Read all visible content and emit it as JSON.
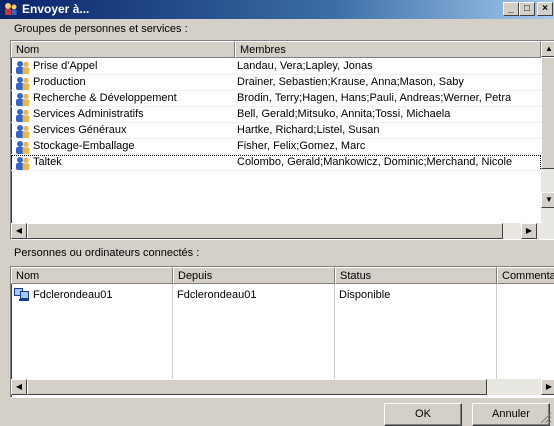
{
  "window": {
    "title": "Envoyer à...",
    "buttons": [
      "_",
      "□",
      "×"
    ]
  },
  "groups": {
    "label": "Groupes de personnes et services :",
    "columns": [
      "Nom",
      "Membres"
    ],
    "rows": [
      {
        "name": "Prise d'Appel",
        "members": "Landau, Vera;Lapley, Jonas"
      },
      {
        "name": "Production",
        "members": "Drainer, Sebastien;Krause, Anna;Mason, Saby"
      },
      {
        "name": "Recherche & Développement",
        "members": "Brodin, Terry;Hagen, Hans;Pauli, Andreas;Werner, Petra"
      },
      {
        "name": "Services Administratifs",
        "members": "Bell, Gerald;Mitsuko, Annita;Tossi, Michaela"
      },
      {
        "name": "Services Généraux",
        "members": "Hartke, Richard;Listel, Susan"
      },
      {
        "name": "Stockage-Emballage",
        "members": "Fisher, Felix;Gomez, Marc"
      },
      {
        "name": "Taltek",
        "members": "Colombo, Gerald;Mankowicz, Dominic;Merchand, Nicole"
      }
    ],
    "selected_row": "Taltek"
  },
  "connected": {
    "label": "Personnes ou ordinateurs connectés :",
    "columns": [
      "Nom",
      "Depuis",
      "Status",
      "Commentaire"
    ],
    "rows": [
      {
        "name": "Fdclerondeau01",
        "since": "Fdclerondeau01",
        "status": "Disponible",
        "comment": ""
      }
    ]
  },
  "footer": {
    "ok_label": "OK",
    "cancel_label": "Annuler"
  },
  "colors": {
    "title_start": "#0a246a",
    "title_end": "#a6caf0",
    "face": "#d4d0c8",
    "icon_people": "#3366cc"
  }
}
